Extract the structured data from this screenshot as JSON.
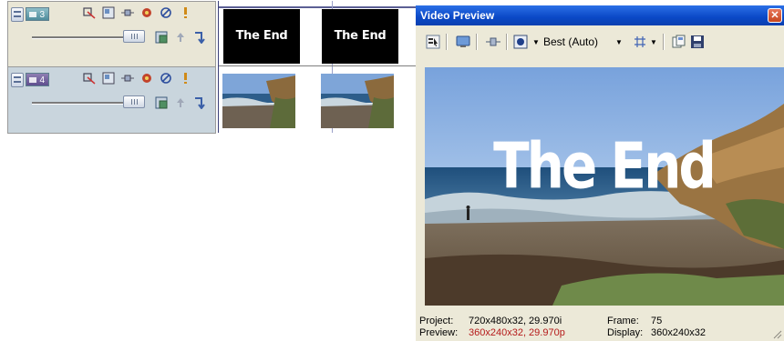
{
  "tracks": [
    {
      "number": "3",
      "color": "#4f8c9c"
    },
    {
      "number": "4",
      "color": "#5f4e8e"
    }
  ],
  "track_icons": [
    "track-motion-icon",
    "track-fx-icon",
    "compositing-icon",
    "gear-icon",
    "mute-icon",
    "solo-icon"
  ],
  "timeline": {
    "clip_title_text": "The End"
  },
  "preview": {
    "window_title": "Video Preview",
    "toolbar": {
      "quality": "Best (Auto)"
    },
    "overlay_title": "The End",
    "status": {
      "project_label": "Project:",
      "project_value": "720x480x32, 29.970i",
      "preview_label": "Preview:",
      "preview_value": "360x240x32, 29.970p",
      "frame_label": "Frame:",
      "frame_value": "75",
      "display_label": "Display:",
      "display_value": "360x240x32"
    }
  }
}
